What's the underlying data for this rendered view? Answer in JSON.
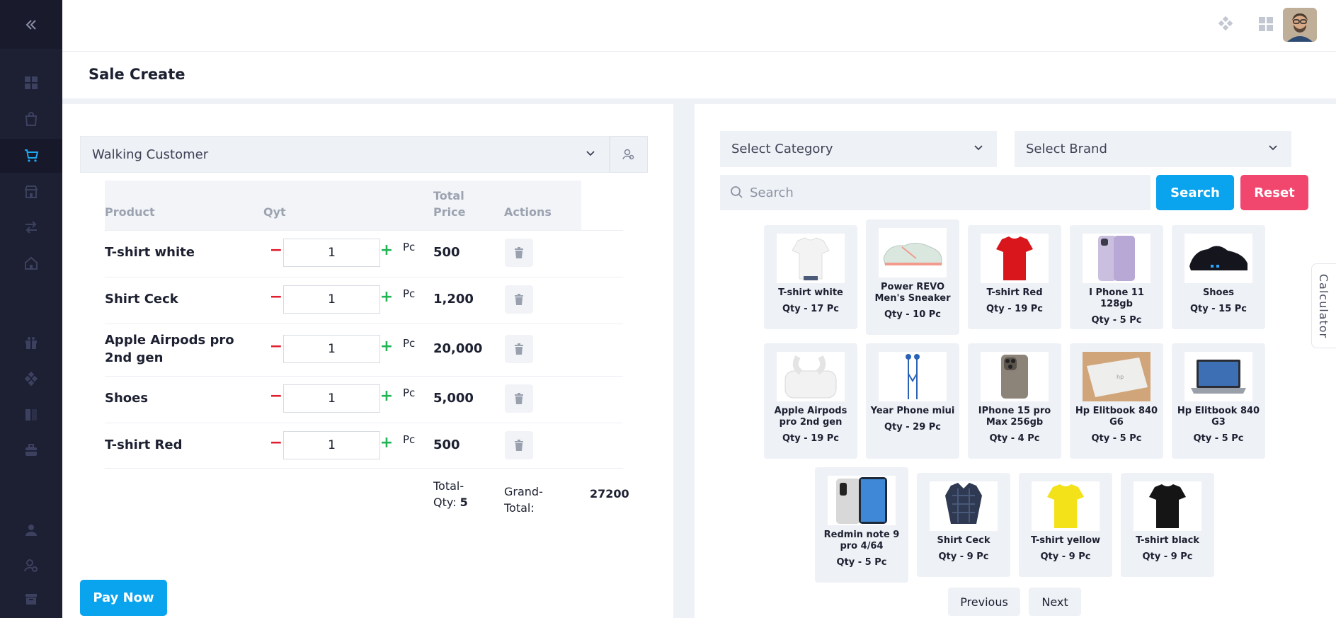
{
  "sidebar": {
    "toggle_icon": "double-chevron-left-icon",
    "items": [
      {
        "icon": "dashboard-icon"
      },
      {
        "icon": "shopping-bag-icon"
      },
      {
        "icon": "cart-icon",
        "active": true
      },
      {
        "icon": "store-icon"
      },
      {
        "icon": "transfer-icon"
      },
      {
        "icon": "home-icon"
      },
      {
        "icon": "gift-icon"
      },
      {
        "icon": "diamond-icon"
      },
      {
        "icon": "report-icon"
      },
      {
        "icon": "briefcase-icon"
      },
      {
        "icon": "user-icon"
      },
      {
        "icon": "user-settings-icon"
      },
      {
        "icon": "archive-icon"
      }
    ]
  },
  "header": {
    "icons": [
      "apps-diamond-icon",
      "grid-icon",
      "avatar"
    ],
    "page_title": "Sale Create"
  },
  "customer": {
    "selected": "Walking Customer"
  },
  "cart_table": {
    "headers": {
      "product": "Product",
      "qty": "Qyt",
      "total_price": "Total Price",
      "actions": "Actions"
    },
    "rows": [
      {
        "product": "T-shirt white",
        "qty": "1",
        "unit": "Pc",
        "price": "500"
      },
      {
        "product": "Shirt Ceck",
        "qty": "1",
        "unit": "Pc",
        "price": "1,200"
      },
      {
        "product": "Apple Airpods pro 2nd gen",
        "qty": "1",
        "unit": "Pc",
        "price": "20,000"
      },
      {
        "product": "Shoes",
        "qty": "1",
        "unit": "Pc",
        "price": "5,000"
      },
      {
        "product": "T-shirt Red",
        "qty": "1",
        "unit": "Pc",
        "price": "500"
      }
    ],
    "minus_symbol": "−",
    "plus_symbol": "+",
    "totals": {
      "total_qty_label": "Total-Qty:",
      "total_qty_value": "5",
      "grand_total_label": "Grand-Total:",
      "grand_total_value": "27200"
    }
  },
  "pay_button": "Pay Now",
  "filters": {
    "category_placeholder": "Select Category",
    "brand_placeholder": "Select Brand",
    "search_placeholder": "Search",
    "search_button": "Search",
    "reset_button": "Reset"
  },
  "products": [
    {
      "name": "T-shirt white",
      "qty": "Qty - 17 Pc",
      "color": "#f4f4f4"
    },
    {
      "name": "Power REVO Men's Sneaker",
      "qty": "Qty - 10 Pc",
      "color": "#d9e7df"
    },
    {
      "name": "T-shirt Red",
      "qty": "Qty - 19 Pc",
      "color": "#d8161c"
    },
    {
      "name": "I Phone 11 128gb",
      "qty": "Qty - 5 Pc",
      "color": "#cbbfe0"
    },
    {
      "name": "Shoes",
      "qty": "Qty - 15 Pc",
      "color": "#15161d"
    },
    {
      "name": "Apple Airpods pro 2nd gen",
      "qty": "Qty - 19 Pc",
      "color": "#f2f2f2"
    },
    {
      "name": "Year Phone miui",
      "qty": "Qty - 29 Pc",
      "color": "#2a62b8"
    },
    {
      "name": "IPhone 15 pro Max 256gb",
      "qty": "Qty - 4 Pc",
      "color": "#8c8478"
    },
    {
      "name": "Hp Elitbook 840 G6",
      "qty": "Qty - 5 Pc",
      "color": "#d9d3c9"
    },
    {
      "name": "Hp Elitbook 840 G3",
      "qty": "Qty - 5 Pc",
      "color": "#3c6fb4"
    },
    {
      "name": "Redmin note 9 pro 4/64",
      "qty": "Qty - 5 Pc",
      "color": "#3f88d8"
    },
    {
      "name": "Shirt Ceck",
      "qty": "Qty - 9 Pc",
      "color": "#2f3a52"
    },
    {
      "name": "T-shirt yellow",
      "qty": "Qty - 9 Pc",
      "color": "#f3e21a"
    },
    {
      "name": "T-shirt black",
      "qty": "Qty - 9 Pc",
      "color": "#151515"
    }
  ],
  "pagination": {
    "previous": "Previous",
    "next": "Next"
  },
  "calculator_tab": "Calculator"
}
